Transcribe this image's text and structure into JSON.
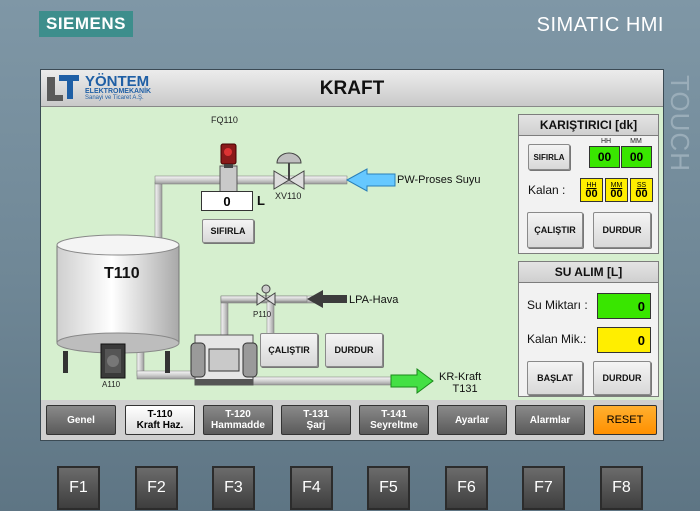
{
  "device": {
    "brand": "SIEMENS",
    "model": "SIMATIC HMI",
    "side_label": "TOUCH"
  },
  "header": {
    "logo": {
      "name": "YÖNTEM",
      "line2": "ELEKTROMEKANİK",
      "line3": "Sanayi ve Ticaret A.Ş."
    },
    "title": "KRAFT"
  },
  "process": {
    "tank_label": "T110",
    "flow_meter_tag": "FQ110",
    "flow_value": "0",
    "flow_unit": "L",
    "reset_flow_label": "SIFIRLA",
    "valve_tag": "XV110",
    "water_source_label": "PW-Proses Suyu",
    "air_source_label": "LPA-Hava",
    "air_valve_tag": "P110",
    "motor_tag": "A110",
    "pump_start_label": "ÇALIŞTIR",
    "pump_stop_label": "DURDUR",
    "outlet_label_line1": "KR-Kraft",
    "outlet_label_line2": "T131"
  },
  "mixer_panel": {
    "title": "KARIŞTIRICI [dk]",
    "reset_label": "SIFIRLA",
    "set_hh_label": "HH",
    "set_mm_label": "MM",
    "set_hh": "00",
    "set_mm": "00",
    "remaining_label": "Kalan :",
    "rem_hh_label": "HH",
    "rem_mm_label": "MM",
    "rem_ss_label": "SS",
    "rem_hh": "00",
    "rem_mm": "00",
    "rem_ss": "00",
    "start_label": "ÇALIŞTIR",
    "stop_label": "DURDUR"
  },
  "water_panel": {
    "title": "SU ALIM [L]",
    "amount_label": "Su Miktarı :",
    "amount_value": "0",
    "remaining_label": "Kalan Mik.:",
    "remaining_value": "0",
    "start_label": "BAŞLAT",
    "stop_label": "DURDUR"
  },
  "tabs": [
    {
      "line1": "Genel",
      "line2": ""
    },
    {
      "line1": "T-110",
      "line2": "Kraft Haz."
    },
    {
      "line1": "T-120",
      "line2": "Hammadde"
    },
    {
      "line1": "T-131",
      "line2": "Şarj"
    },
    {
      "line1": "T-141",
      "line2": "Seyreltme"
    },
    {
      "line1": "Ayarlar",
      "line2": ""
    },
    {
      "line1": "Alarmlar",
      "line2": ""
    },
    {
      "line1": "RESET",
      "line2": ""
    }
  ],
  "function_keys": [
    "F1",
    "F2",
    "F3",
    "F4",
    "F5",
    "F6",
    "F7",
    "F8"
  ],
  "colors": {
    "accent_green": "#39e600",
    "accent_yellow": "#ffee00",
    "screen_bg": "#d6efcf",
    "reset_orange": "#ff9a1a"
  }
}
